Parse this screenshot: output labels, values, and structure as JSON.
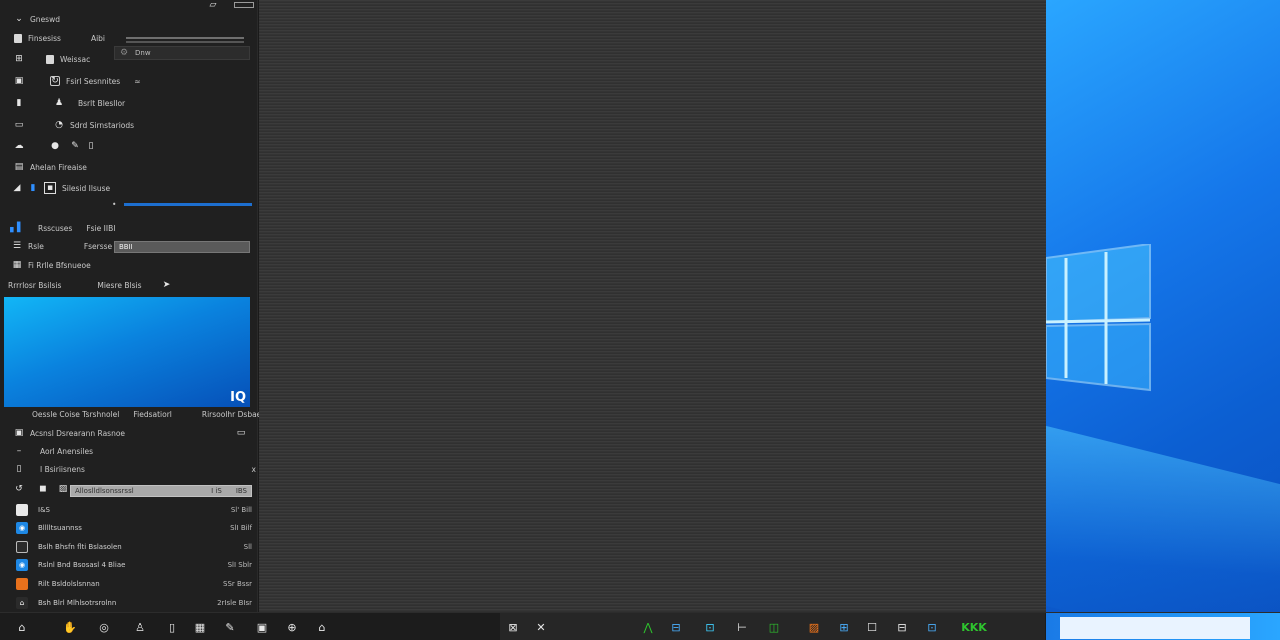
{
  "sidebar": {
    "title_row": "Gneswd",
    "row1": {
      "left": "Finsesiss",
      "right": "Aibi"
    },
    "field1_text": "",
    "field2_text": "Dnw",
    "row2": "Weissac",
    "row3": "Fsirl Sesnnites",
    "row4": "Bsrlt Blesllor",
    "row5": "Sdrd Sirnstariods",
    "row6": "",
    "row7": "Ahelan Fireaise",
    "row8": "Silesid Ilsuse",
    "row9": {
      "left": "Rsscuses",
      "right": "Fsie IIBI"
    },
    "row10": {
      "left": "Rsle",
      "right": "Fsersse",
      "field": "BBII"
    },
    "row11": "Fi Rrlle Bfsnueoe",
    "row12": {
      "left": "Rrrrlosr Bsilsis",
      "right": "Miesre Blsis"
    },
    "preview_logo": "IQ",
    "caption": {
      "left": "Oessle Coise Tsrshnolel",
      "mid": "Fiedsatiorl",
      "right": "Rirsoolhr Dsbae"
    },
    "row13": "Acsnsl Dsrearann Rasnoe",
    "row14": "Aorl Anensiles",
    "row15": "I Bsiriisnens",
    "close_mark": "x",
    "selected_field": {
      "text": "Alloslldlsonssrssl",
      "mid": "I iS",
      "right": "IBS"
    },
    "list": [
      {
        "label": "I&S",
        "right": "Sl' Bill"
      },
      {
        "label": "Blllltsuannss",
        "right": "SlI Bilf"
      },
      {
        "label": "Bslh Bhsfn flti Bslasolen",
        "right": "Sll"
      },
      {
        "label": "Rslnl Bnd Bsosasl 4 Bliae",
        "right": "SlI Sblr"
      },
      {
        "label": "Rilt Bsldolslsnnan",
        "right": "SSr Bssr"
      },
      {
        "label": "Bsh Blrl Mlhlsotrsrolnn",
        "right": "2rIsle BIsr"
      }
    ]
  },
  "taskbar": {
    "icons_left": [
      "⌂",
      "✋",
      "◎",
      "♙",
      "▯",
      "▦",
      "✎",
      "▣",
      "⊕",
      "⌂"
    ],
    "icons_mid": [
      "⊠",
      "✕",
      "⋀",
      "⊟",
      "⊡",
      "⊢",
      "◫",
      "▨",
      "⊞",
      "☐",
      "⊟",
      "⊡",
      "ꓘ"
    ],
    "green_label": "KKK"
  },
  "colors": {
    "accent": "#1d6fd0",
    "wallpaper": "#1577ea",
    "green": "#2ec42e"
  }
}
